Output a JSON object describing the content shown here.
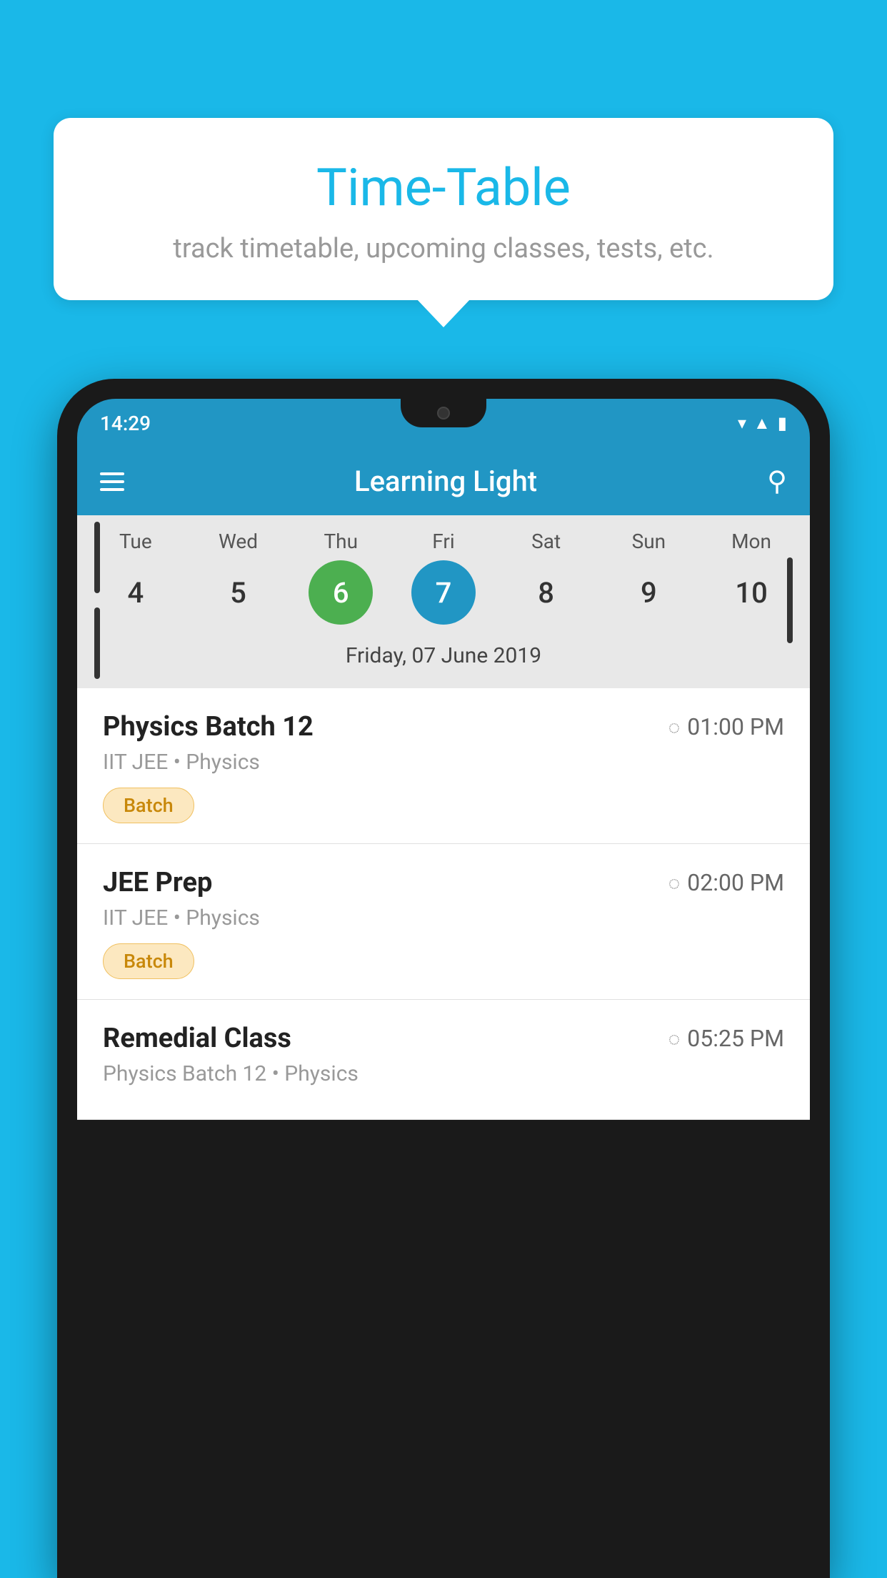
{
  "background_color": "#1ab8e8",
  "tooltip": {
    "title": "Time-Table",
    "subtitle": "track timetable, upcoming classes, tests, etc."
  },
  "phone": {
    "status_bar": {
      "time": "14:29"
    },
    "app_header": {
      "title": "Learning Light"
    },
    "calendar": {
      "days": [
        {
          "label": "Tue",
          "number": "4"
        },
        {
          "label": "Wed",
          "number": "5"
        },
        {
          "label": "Thu",
          "number": "6",
          "state": "today"
        },
        {
          "label": "Fri",
          "number": "7",
          "state": "selected"
        },
        {
          "label": "Sat",
          "number": "8"
        },
        {
          "label": "Sun",
          "number": "9"
        },
        {
          "label": "Mon",
          "number": "10"
        }
      ],
      "selected_date": "Friday, 07 June 2019"
    },
    "schedule": [
      {
        "title": "Physics Batch 12",
        "time": "01:00 PM",
        "detail": "IIT JEE • Physics",
        "badge": "Batch"
      },
      {
        "title": "JEE Prep",
        "time": "02:00 PM",
        "detail": "IIT JEE • Physics",
        "badge": "Batch"
      },
      {
        "title": "Remedial Class",
        "time": "05:25 PM",
        "detail": "Physics Batch 12 • Physics",
        "badge": null
      }
    ]
  }
}
